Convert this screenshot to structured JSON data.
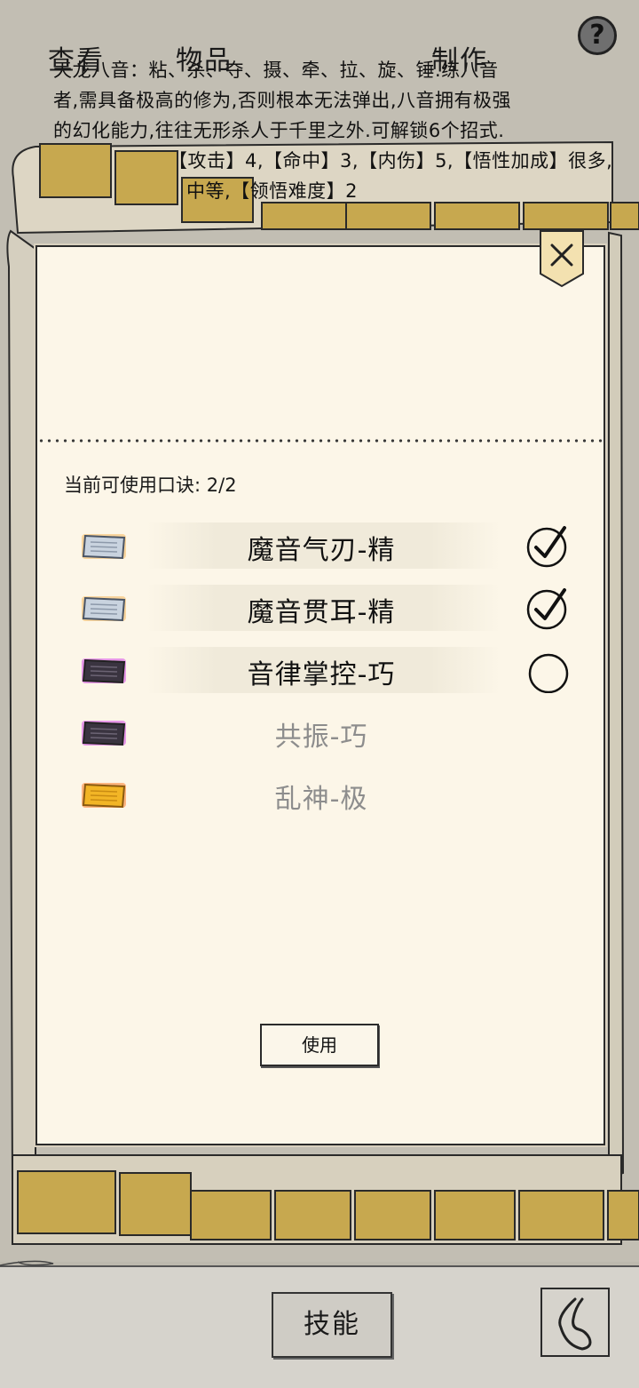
{
  "description": {
    "lines": [
      "天龙八音：粘、杀、夺、摄、牵、拉、旋、锤.练八音",
      "者,需具备极高的修为,否则根本无法弹出,八音拥有极强",
      "的幻化能力,往往无形杀人于千里之外.可解锁6个招式.",
      "【攻击】4,【命中】3,【内伤】5,【悟性加成】很多,",
      "中等,【领悟难度】2"
    ]
  },
  "help_label": "?",
  "panel": {
    "count_label": "当前可使用口诀:",
    "count_value": "2/2",
    "skills": [
      {
        "name": "魔音气刃-精",
        "book_color": "silver",
        "checked": true,
        "enabled": true
      },
      {
        "name": "魔音贯耳-精",
        "book_color": "silver",
        "checked": true,
        "enabled": true
      },
      {
        "name": "音律掌控-巧",
        "book_color": "purple",
        "checked": false,
        "enabled": true
      },
      {
        "name": "共振-巧",
        "book_color": "purple",
        "checked": false,
        "enabled": false
      },
      {
        "name": "乱神-极",
        "book_color": "gold",
        "checked": false,
        "enabled": false
      }
    ],
    "use_button_label": "使用"
  },
  "tabs": [
    {
      "label": "查看",
      "active": false
    },
    {
      "label": "物品",
      "active": false
    },
    {
      "label": "技能",
      "active": true
    },
    {
      "label": "制作",
      "active": false
    }
  ],
  "colors": {
    "panel_bg": "#fcf6e8",
    "tabbar_bg": "#d6d3cc",
    "silver_glow": "#f0a63c",
    "purple_glow": "#c23bd6",
    "gold_glow": "#e8a020"
  }
}
